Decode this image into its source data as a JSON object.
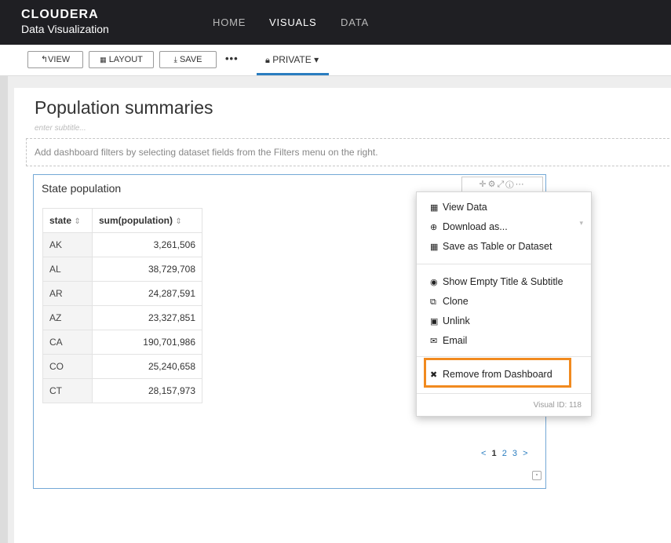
{
  "brand": {
    "name": "CLOUDERA",
    "product": "Data Visualization"
  },
  "nav": {
    "home": "HOME",
    "visuals": "VISUALS",
    "data": "DATA"
  },
  "toolbar": {
    "view": "↰VIEW",
    "layout": "LAYOUT",
    "save": "SAVE",
    "more": "•••",
    "privacy": "PRIVATE ▾"
  },
  "dashboard": {
    "title": "Population summaries",
    "subtitle_placeholder": "enter subtitle...",
    "filters_hint": "Add dashboard filters by selecting dataset fields from the Filters menu on the right."
  },
  "visual": {
    "title": "State population",
    "columns": [
      "state",
      "sum(population)"
    ],
    "rows": [
      [
        "AK",
        "3,261,506"
      ],
      [
        "AL",
        "38,729,708"
      ],
      [
        "AR",
        "24,287,591"
      ],
      [
        "AZ",
        "23,327,851"
      ],
      [
        "CA",
        "190,701,986"
      ],
      [
        "CO",
        "25,240,658"
      ],
      [
        "CT",
        "28,157,973"
      ]
    ],
    "pager": {
      "prev": "<",
      "pages": [
        "1",
        "2",
        "3"
      ],
      "next": ">"
    }
  },
  "menu": {
    "items": [
      {
        "icon": "table-icon",
        "label": "View Data"
      },
      {
        "icon": "download-icon",
        "label": "Download as..."
      },
      {
        "icon": "table-icon",
        "label": "Save as Table or Dataset"
      },
      {
        "icon": "eye-icon",
        "label": "Show Empty Title & Subtitle"
      },
      {
        "icon": "clone-icon",
        "label": "Clone"
      },
      {
        "icon": "unlink-icon",
        "label": "Unlink"
      },
      {
        "icon": "envelope-icon",
        "label": "Email"
      },
      {
        "icon": "close-icon",
        "label": "Remove from Dashboard"
      }
    ],
    "visual_id": "Visual ID: 118"
  },
  "colors": {
    "topbar": "#1f1f23",
    "accent": "#2a7dc0",
    "highlight": "#f18a1f",
    "visual_border": "#74a8d6"
  }
}
